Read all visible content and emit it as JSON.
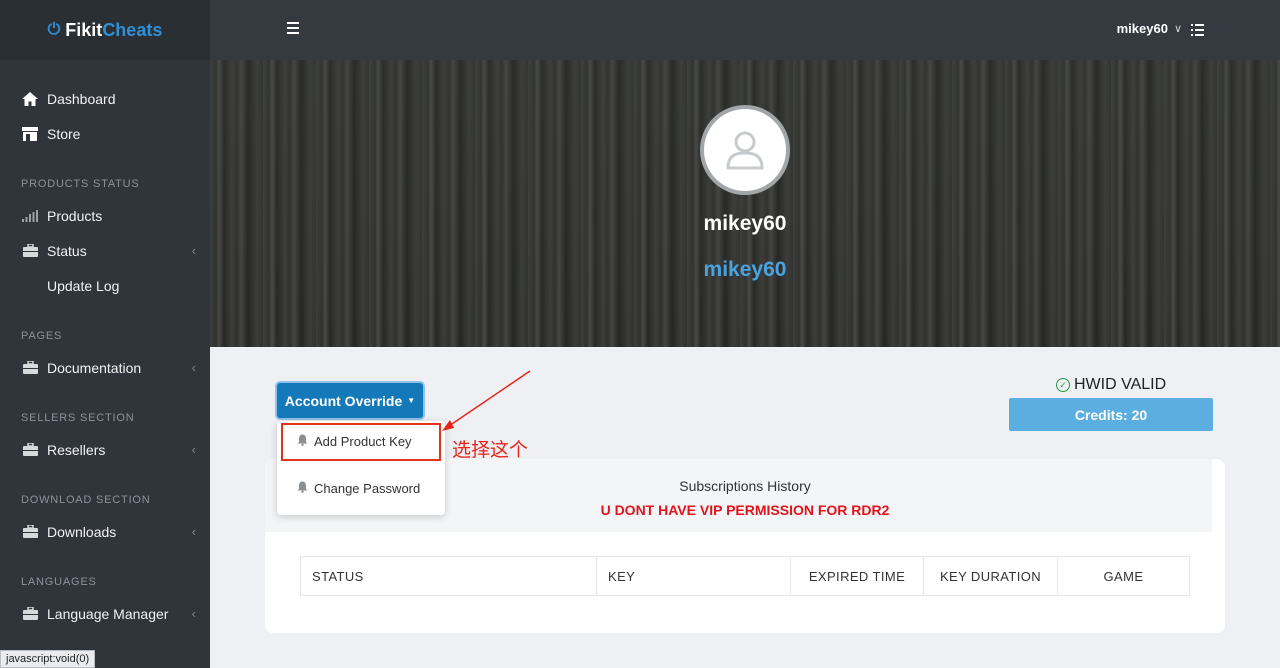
{
  "brand": {
    "part1": "Fikit",
    "part2": "Cheats",
    "icon": "power-icon"
  },
  "sidebar": {
    "items": [
      {
        "type": "item",
        "label": "Dashboard",
        "icon": "home-icon"
      },
      {
        "type": "item",
        "label": "Store",
        "icon": "store-icon"
      },
      {
        "type": "header",
        "label": "PRODUCTS STATUS"
      },
      {
        "type": "item",
        "label": "Products",
        "icon": "signal-icon"
      },
      {
        "type": "item",
        "label": "Status",
        "icon": "briefcase-icon",
        "chevron": true
      },
      {
        "type": "sub",
        "label": "Update Log"
      },
      {
        "type": "header",
        "label": "PAGES"
      },
      {
        "type": "item",
        "label": "Documentation",
        "icon": "briefcase-icon",
        "chevron": true
      },
      {
        "type": "header",
        "label": "SELLERS SECTION"
      },
      {
        "type": "item",
        "label": "Resellers",
        "icon": "briefcase-icon",
        "chevron": true
      },
      {
        "type": "header",
        "label": "DOWNLOAD SECTION"
      },
      {
        "type": "item",
        "label": "Downloads",
        "icon": "briefcase-icon",
        "chevron": true
      },
      {
        "type": "header",
        "label": "LANGUAGES"
      },
      {
        "type": "item",
        "label": "Language Manager",
        "icon": "briefcase-icon",
        "chevron": true
      }
    ]
  },
  "topbar": {
    "username": "mikey60"
  },
  "hero": {
    "name": "mikey60",
    "username": "mikey60"
  },
  "account": {
    "button_label": "Account Override",
    "menu": [
      {
        "label": "Add Product Key",
        "icon": "bell-icon"
      },
      {
        "label": "Change Password",
        "icon": "bell-icon"
      }
    ]
  },
  "hwid": {
    "label": "HWID VALID"
  },
  "credits": {
    "label": "Credits: 20"
  },
  "subscriptions": {
    "title": "Subscriptions History",
    "warning": "U DONT HAVE VIP PERMISSION FOR RDR2",
    "columns": [
      "STATUS",
      "KEY",
      "EXPIRED TIME",
      "KEY DURATION",
      "GAME"
    ]
  },
  "annotation": {
    "text": "选择这个"
  },
  "statusbar": {
    "text": "javascript:void(0)"
  },
  "colors": {
    "accent": "#1479b8",
    "credits": "#5aaee0",
    "warning": "#e0141c",
    "annotation": "#e8241a"
  }
}
